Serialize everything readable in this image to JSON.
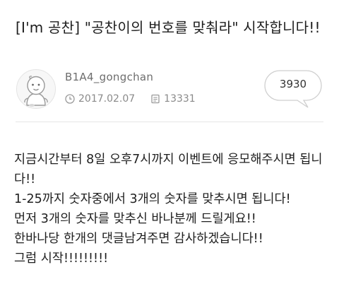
{
  "post": {
    "title": "[I'm 공찬] \"공찬이의 번호를 맞춰라\" 시작합니다!!",
    "author": "B1A4_gongchan",
    "date": "2017.02.07",
    "views": "13331",
    "comment_count": "3930",
    "body_lines": [
      "지금시간부터 8일 오후7시까지 이벤트에 응모해주시면 됩니다!!",
      "1-25까지 숫자중에서 3개의 숫자를 맞추시면 됩니다!",
      "먼저 3개의 숫자를 맞추신 바나분께 드릴게요!!",
      "한바나당 한개의 댓글남겨주면 감사하겠습니다!!",
      "그럼 시작!!!!!!!!!"
    ]
  },
  "icons": {
    "avatar": "cartoon-character-avatar",
    "date": "clock-icon",
    "views": "document-icon",
    "comments": "speech-bubble-icon"
  }
}
